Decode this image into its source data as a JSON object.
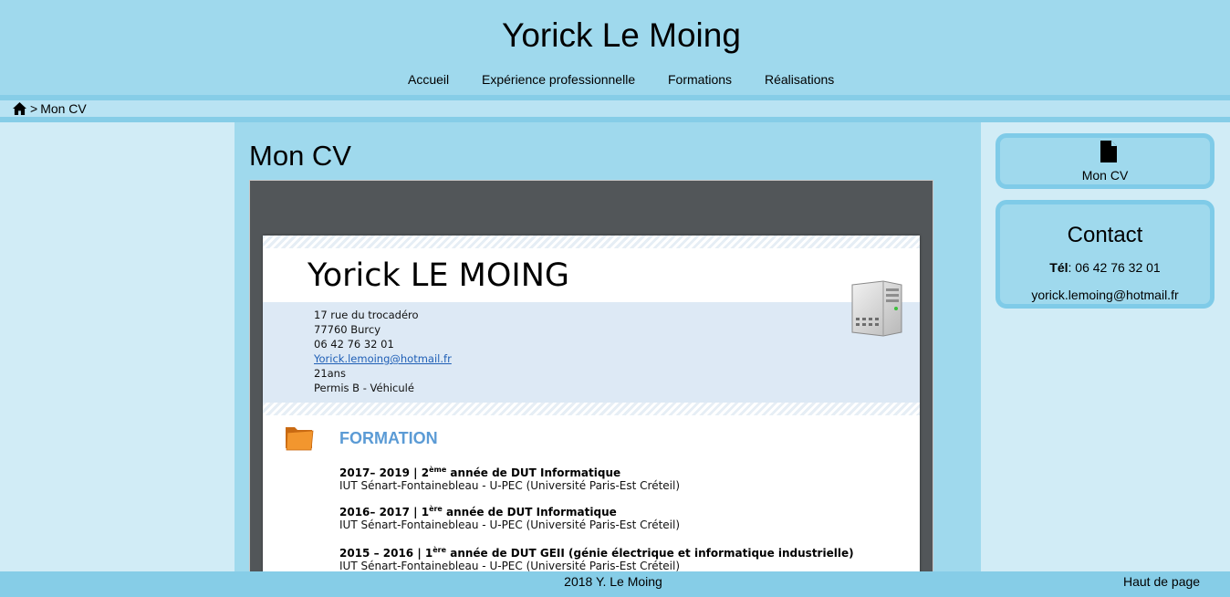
{
  "site": {
    "title": "Yorick Le Moing"
  },
  "nav": {
    "items": [
      {
        "label": "Accueil"
      },
      {
        "label": "Expérience professionnelle"
      },
      {
        "label": "Formations"
      },
      {
        "label": "Réalisations"
      }
    ]
  },
  "breadcrumb": {
    "home_icon": "home-icon",
    "separator": ">",
    "current": "Mon CV"
  },
  "main": {
    "heading": "Mon CV",
    "cv_document": {
      "name": "Yorick LE MOING",
      "address_lines": [
        "17 rue du trocadéro",
        "77760 Burcy",
        "06 42 76 32 01",
        "Yorick.lemoing@hotmail.fr",
        "21ans",
        "Permis B - Véhiculé"
      ],
      "section_title": "FORMATION",
      "entries": [
        {
          "years": "2017– 2019 | 2",
          "sup": "ème",
          "rest": " année de DUT Informatique",
          "school": "IUT Sénart-Fontainebleau - U-PEC (Université Paris-Est Créteil)"
        },
        {
          "years": "2016– 2017 | 1",
          "sup": "ère",
          "rest": " année de DUT Informatique",
          "school": "IUT Sénart-Fontainebleau - U-PEC (Université Paris-Est Créteil)"
        },
        {
          "years": "2015 – 2016 | 1",
          "sup": "ère",
          "rest": " année de DUT GEII (génie électrique et informatique industrielle)",
          "school": "IUT Sénart-Fontainebleau - U-PEC (Université Paris-Est Créteil)"
        }
      ]
    }
  },
  "sidebar": {
    "cv_card": {
      "icon": "file-icon",
      "label": "Mon CV"
    },
    "contact": {
      "title": "Contact",
      "phone_label": "Tél",
      "phone_value": ": 06 42 76 32 01",
      "email": "yorick.lemoing@hotmail.fr"
    }
  },
  "footer": {
    "copyright": "2018 Y. Le Moing",
    "back_to_top": "Haut de page"
  },
  "colors": {
    "header_bg": "#9fd9ed",
    "side_bg": "#d1ecf6",
    "accent_bar": "#86cde7",
    "pdf_viewer_bg": "#525659",
    "formation_heading": "#5b9bd5",
    "link_blue": "#1f5fb6"
  }
}
